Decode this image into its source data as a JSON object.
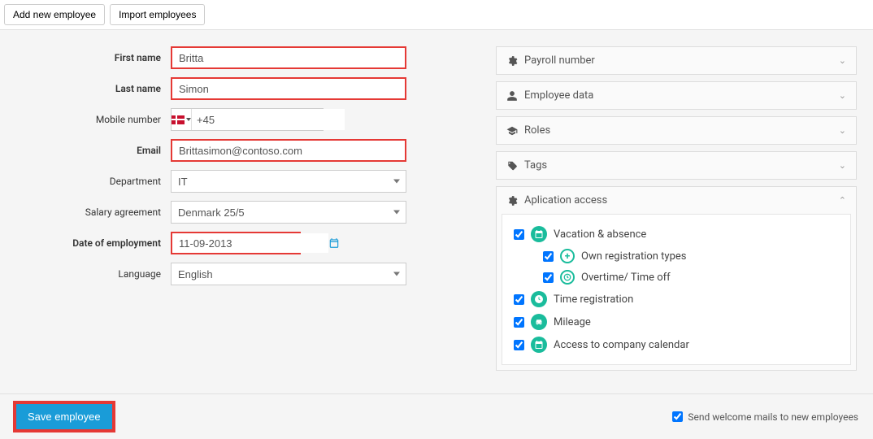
{
  "toolbar": {
    "add_label": "Add new employee",
    "import_label": "Import employees"
  },
  "form": {
    "first_name_label": "First name",
    "first_name": "Britta",
    "last_name_label": "Last name",
    "last_name": "Simon",
    "mobile_label": "Mobile number",
    "mobile_prefix": "+45",
    "email_label": "Email",
    "email": "Brittasimon@contoso.com",
    "department_label": "Department",
    "department": "IT",
    "salary_label": "Salary agreement",
    "salary": "Denmark 25/5",
    "doe_label": "Date of employment",
    "doe": "11-09-2013",
    "language_label": "Language",
    "language": "English"
  },
  "panels": {
    "payroll": "Payroll number",
    "employee_data": "Employee data",
    "roles": "Roles",
    "tags": "Tags",
    "app_access": "Aplication access"
  },
  "access": {
    "vacation": "Vacation & absence",
    "own_reg": "Own registration types",
    "overtime": "Overtime/ Time off",
    "time_reg": "Time registration",
    "mileage": "Mileage",
    "calendar": "Access to company calendar"
  },
  "footer": {
    "save": "Save employee",
    "welcome": "Send welcome mails to new employees"
  }
}
